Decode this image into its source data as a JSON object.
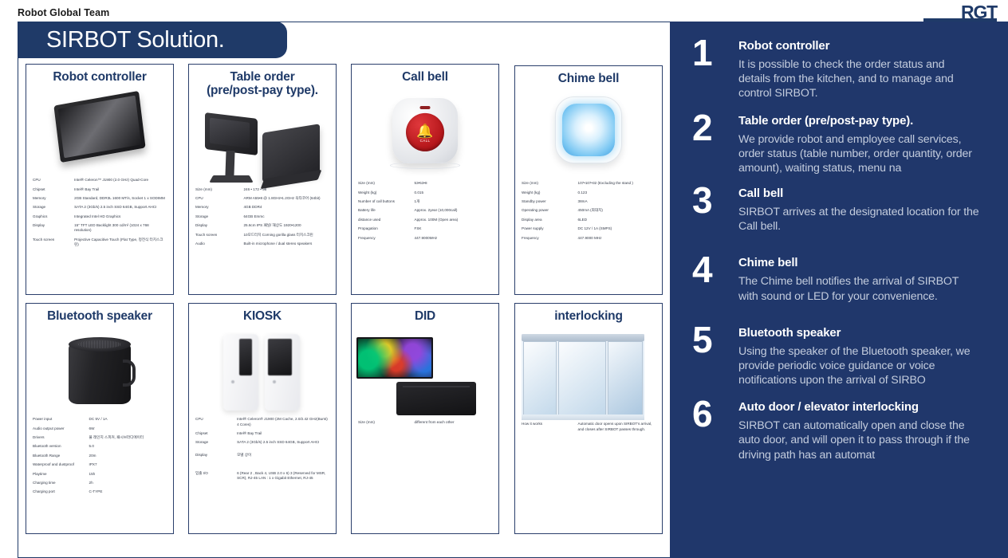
{
  "header": {
    "title": "Robot Global Team",
    "logo_text": "RGT"
  },
  "slide": {
    "title": "SIRBOT Solution."
  },
  "cards": [
    {
      "name": "robot-controller",
      "title": "Robot controller",
      "title_line2": "",
      "art": "monitor",
      "specs": [
        {
          "key": "CPU",
          "value": "Intel® Celeron™ J1900 (2.0 GHz) Quad-Core"
        },
        {
          "key": "Chipset",
          "value": "Intel® Bay Trail"
        },
        {
          "key": "Memory",
          "value": "2GB Standard, DDR3L 1600 MT/s, Socket 1 x SODIMM"
        },
        {
          "key": "Storage",
          "value": "SATA 2 (3Gb/s) 2.5 inch SSD 64GB, Support AHCI"
        },
        {
          "key": "Graphics",
          "value": "Integrated Intel HD Graphics"
        },
        {
          "key": "Display",
          "value": "15\" TFT LED Backlight 300 cd/m² (1024 x 768 resolution)"
        },
        {
          "key": "Touch screen",
          "value": "Projective Capacitive Touch (Flat Type, 정전식 터치스크린)"
        }
      ]
    },
    {
      "name": "table-order",
      "title": "Table order",
      "title_line2": "(pre/post-pay type).",
      "art": "pos",
      "specs": [
        {
          "key": "Size (mm)",
          "value": "246 • 172 • 98"
        },
        {
          "key": "CPU",
          "value": "ARM A55•8 @ 1.8GHz•1.2GHz 옥타코어 (64bit)"
        },
        {
          "key": "Memory",
          "value": "4GB DDR4"
        },
        {
          "key": "Storage",
          "value": "64GB Emmc"
        },
        {
          "key": "Display",
          "value": "25.6cm IPS 패널/ 해상도 1920•1200"
        },
        {
          "key": "Touch screen",
          "value": "10모드터치 Corning gorilla glass 터치스크린"
        },
        {
          "key": "Audio",
          "value": "Built-in microphone / dual stereo speakers"
        }
      ]
    },
    {
      "name": "call-bell",
      "title": "Call bell",
      "title_line2": "",
      "art": "callbell",
      "specs": [
        {
          "key": "Size (mm)",
          "value": "53•53•8"
        },
        {
          "key": "Weight  (kg)",
          "value": "0.015"
        },
        {
          "key": "Number of call buttons",
          "value": "1개"
        },
        {
          "key": "Battery life",
          "value": "Approx. 2year (10,000call)"
        },
        {
          "key": "distance used",
          "value": "Approx. 100M (Open area)"
        },
        {
          "key": "Propagation",
          "value": "FSK"
        },
        {
          "key": "Frequency",
          "value": "447.9000MHz"
        }
      ]
    },
    {
      "name": "chime-bell",
      "title": "Chime bell",
      "title_line2": "",
      "art": "chime",
      "specs": [
        {
          "key": "Size (mm)",
          "value": "107•107•32 (Excluding the stand )"
        },
        {
          "key": "Weight  (kg)",
          "value": "0.123"
        },
        {
          "key": "Standby power",
          "value": "38mA"
        },
        {
          "key": "Operating power",
          "value": "450mA (최대치)"
        },
        {
          "key": "Display area",
          "value": "6LED"
        },
        {
          "key": "Power supply",
          "value": "DC 12V / 1A (SMPS)"
        },
        {
          "key": "Frequency",
          "value": "447.9000 MHz"
        }
      ]
    },
    {
      "name": "bluetooth-speaker",
      "title": "Bluetooth speaker",
      "title_line2": "",
      "art": "speaker",
      "specs": [
        {
          "key": "Power input",
          "value": "DC 5V / 1A"
        },
        {
          "key": "Audio output power",
          "value": "6W"
        },
        {
          "key": "Drivers",
          "value": "풀 레인지 스피커, 패시브라디에이터"
        },
        {
          "key": "Bluetooth version",
          "value": "5.0"
        },
        {
          "key": "Bluetooth Range",
          "value": "20m"
        },
        {
          "key": "Waterproof and dustproof",
          "value": "IPX7"
        },
        {
          "key": "Playtime",
          "value": "15h"
        },
        {
          "key": "Charging time",
          "value": "2h"
        },
        {
          "key": "Charging port",
          "value": "C-TYPE"
        }
      ]
    },
    {
      "name": "kiosk",
      "title": "KIOSK",
      "title_line2": "",
      "art": "kiosk",
      "specs": [
        {
          "key": "CPU",
          "value": "Intel® Celeron® J1900 (2M Cache, 2.0/2.42 GHz(Burst) 4 Cores)"
        },
        {
          "key": "Chipset",
          "value": "Intel® Bay Trail"
        },
        {
          "key": "Storage",
          "value": "SATA 2 (3Gb/s) 2.5 inch SSD 64GB, Support AHCI"
        },
        {
          "key": "Display",
          "value": "모델 상이"
        },
        {
          "key": "입출 I/O",
          "value": "6 (Rear 2 , Back 4, USB 2.0 x 6) 3 (Reserved for MSR, SCR), RJ-45 LAN : 1 x Gigabit Ethernet, RJ-45"
        }
      ]
    },
    {
      "name": "did",
      "title": "DID",
      "title_line2": "",
      "art": "did",
      "specs": [
        {
          "key": "Size (mm)",
          "value": "different from each other"
        }
      ]
    },
    {
      "name": "interlocking",
      "title": "interlocking",
      "title_line2": "",
      "art": "door",
      "specs": [
        {
          "key": "How it works",
          "value": "Automatic door opens upon SIRBOT's arrival, and closes after SIRBOT passes through."
        }
      ]
    }
  ],
  "features": [
    {
      "num": "1",
      "title": "Robot controller",
      "desc": "It is possible to check the order status and details from the kitchen, and to manage and control SIRBOT."
    },
    {
      "num": "2",
      "title": "Table order (pre/post-pay type).",
      "desc": "We provide robot and employee call services, order status (table number, order quantity, order amount), waiting status, menu na"
    },
    {
      "num": "3",
      "title": "Call bell",
      "desc": "SIRBOT arrives at the designated location for the Call bell."
    },
    {
      "num": "4",
      "title": "Chime bell",
      "desc": "The Chime bell notifies the arrival of SIRBOT with sound or LED for your convenience."
    },
    {
      "num": "5",
      "title": "Bluetooth speaker",
      "desc": "Using the speaker of the Bluetooth speaker, we provide periodic voice guidance or voice notifications upon the arrival of SIRBO"
    },
    {
      "num": "6",
      "title": "Auto door / elevator interlocking",
      "desc": "SIRBOT can automatically open and close the auto door, and will open it to pass through if the driving path has an automat"
    }
  ],
  "colors": {
    "navy": "#20376b",
    "card_border": "#2a3f6b",
    "title_text": "#1f3a68",
    "desc_text": "#c3ccdd"
  }
}
